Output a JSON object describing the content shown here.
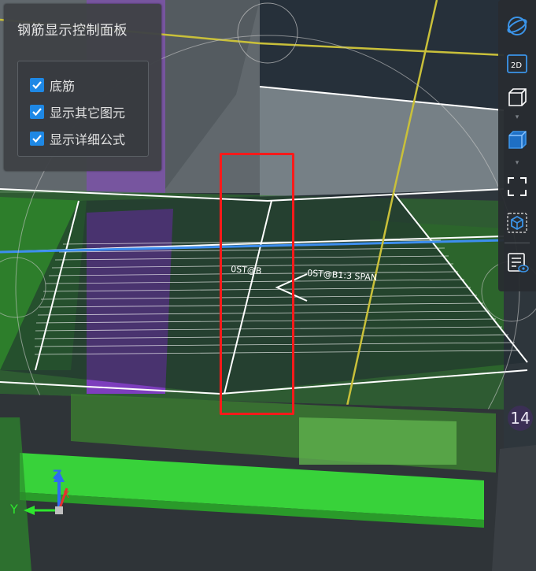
{
  "panel": {
    "title": "钢筋显示控制面板",
    "options": [
      {
        "label": "底筋",
        "checked": true
      },
      {
        "label": "显示其它图元",
        "checked": true
      },
      {
        "label": "显示详细公式",
        "checked": true
      }
    ]
  },
  "toolbar": {
    "buttons": [
      {
        "name": "orbit-icon"
      },
      {
        "name": "view-2d-icon",
        "text": "2D"
      },
      {
        "name": "wireframe-box-icon"
      },
      {
        "name": "solid-box-icon"
      },
      {
        "name": "fit-view-icon"
      },
      {
        "name": "element-box-icon"
      },
      {
        "name": "list-view-icon"
      }
    ]
  },
  "scene": {
    "rebar_text_left": "0ST@B",
    "rebar_text_right": "0ST@B1:3 SPAN",
    "badge": "14",
    "axes": {
      "z": "Z",
      "y": "Y",
      "x": "X"
    }
  },
  "colors": {
    "accent": "#1e88e5",
    "selection": "#ff1a1a",
    "green": "#4cc74c",
    "purple": "#9b4be0",
    "yellow": "#c9c03a"
  }
}
